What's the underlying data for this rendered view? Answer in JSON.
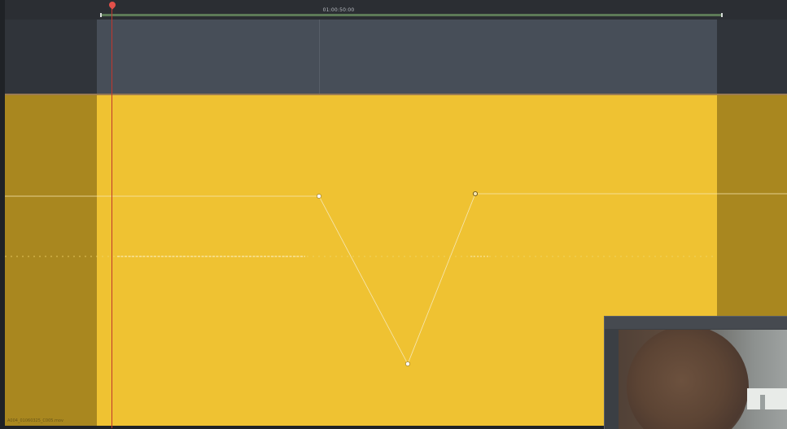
{
  "timeline": {
    "timecode": "01:00:50:00",
    "clip_name": "A004_01060325_C005.mov"
  },
  "keyframe_curve": {
    "keyframes": [
      "keyframe-1",
      "keyframe-2",
      "keyframe-3"
    ]
  },
  "colors": {
    "clip": "#efc232",
    "clip_dimmed": "#a9871f",
    "playhead": "#c1372d",
    "range_bar": "#5d7a57"
  }
}
